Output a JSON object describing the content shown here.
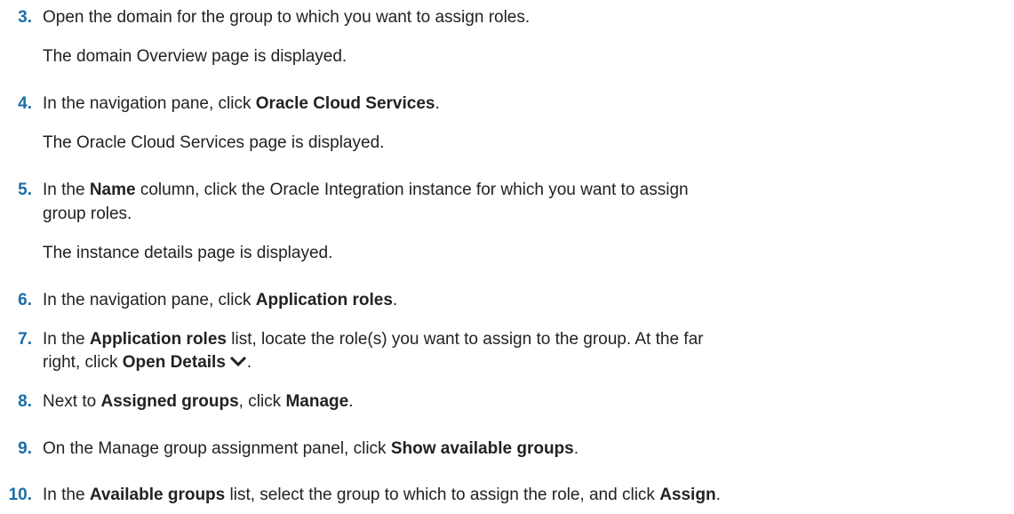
{
  "steps": [
    {
      "number": "3.",
      "text": "Open the domain for the group to which you want to assign roles.",
      "result": "The domain Overview page is displayed."
    },
    {
      "number": "4.",
      "pre": "In the navigation pane, click ",
      "bold": "Oracle Cloud Services",
      "post": ".",
      "result": "The Oracle Cloud Services page is displayed."
    },
    {
      "number": "5.",
      "pre": "In the ",
      "bold": "Name",
      "post": " column, click the Oracle Integration instance for which you want to assign",
      "line2": "group roles.",
      "result": "The instance details page is displayed."
    },
    {
      "number": "6.",
      "pre": "In the navigation pane, click ",
      "bold": "Application roles",
      "post": "."
    },
    {
      "number": "7.",
      "pre": "In the ",
      "bold": "Application roles",
      "post": " list, locate the role(s) you want to assign to the group. At the far",
      "line2_pre": "right, click ",
      "line2_bold": "Open Details",
      "line2_post": ".",
      "icon": "chevron-down-icon"
    },
    {
      "number": "8.",
      "pre": "Next to ",
      "bold": "Assigned groups",
      "mid": ", click ",
      "bold2": "Manage",
      "post": "."
    },
    {
      "number": "9.",
      "pre": "On the Manage group assignment panel, click ",
      "bold": "Show available groups",
      "post": "."
    },
    {
      "number": "10.",
      "pre": "In the ",
      "bold": "Available groups",
      "mid": " list, select the group to which to assign the role, and click ",
      "bold2": "Assign",
      "post": "."
    }
  ]
}
